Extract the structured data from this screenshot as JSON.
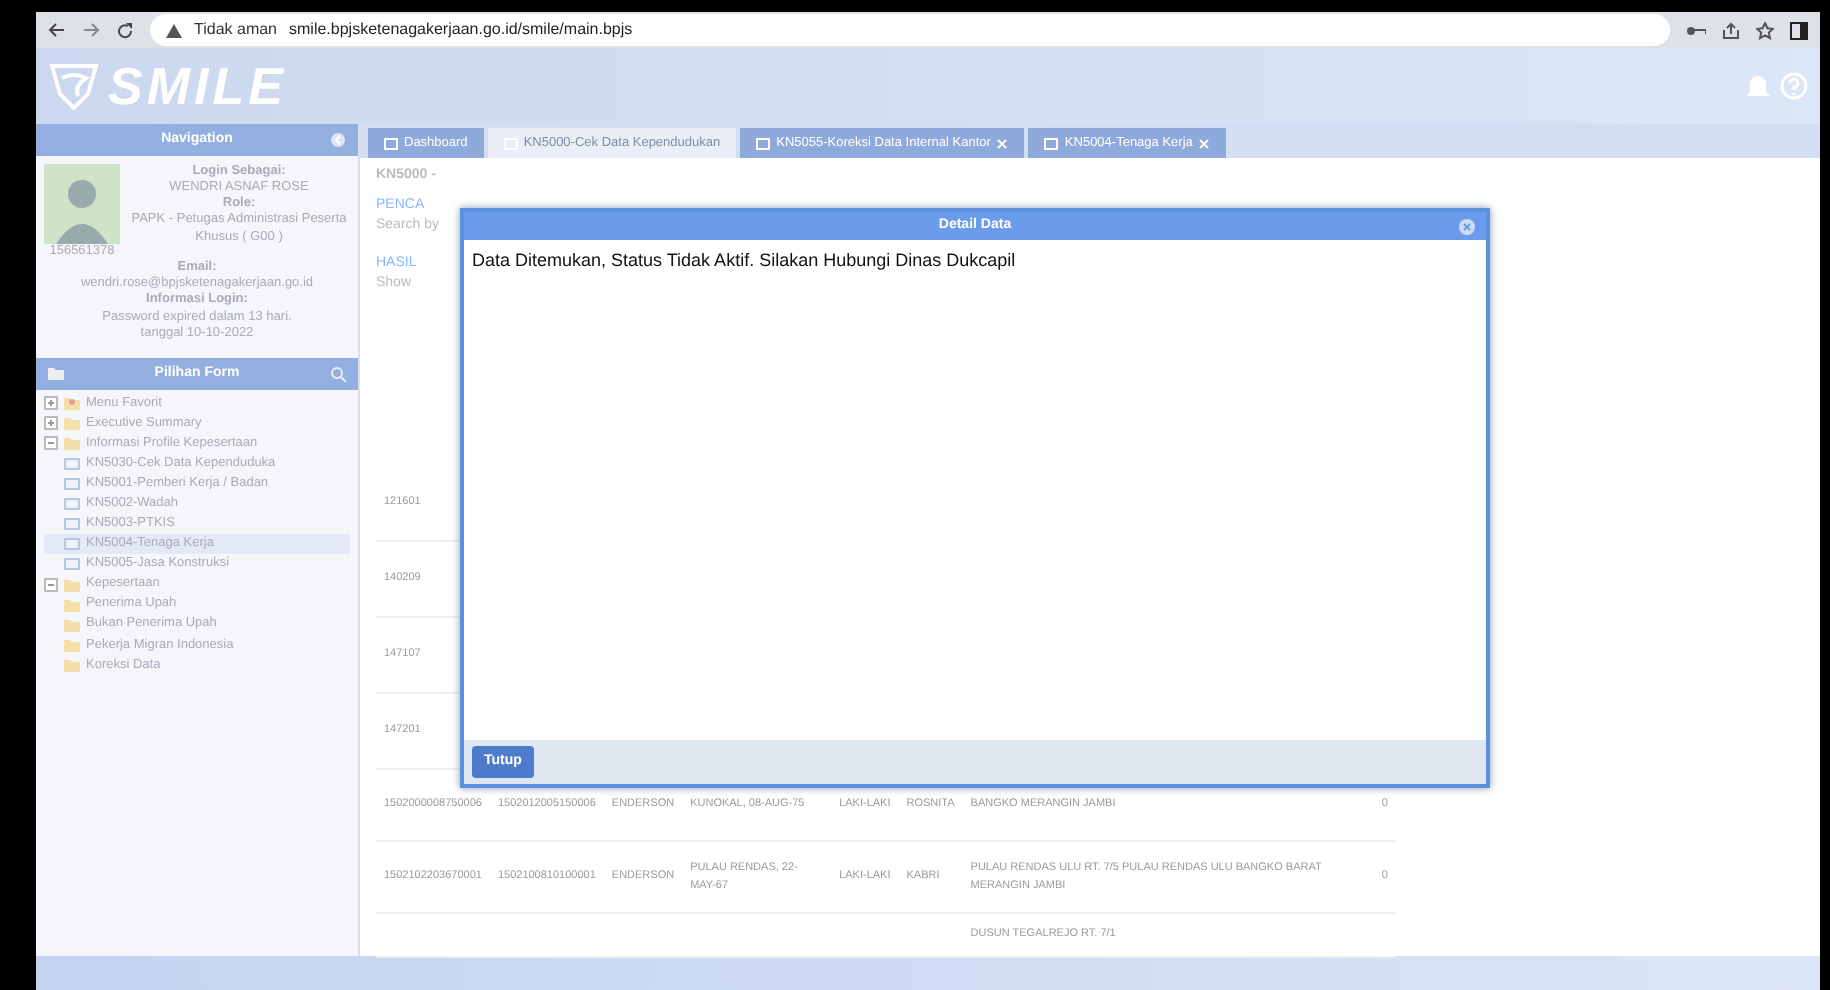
{
  "browser": {
    "security_label": "Tidak aman",
    "url": "smile.bpjsketenagakerjaan.go.id/smile/main.bpjs"
  },
  "header": {
    "logo_text": "SMILE"
  },
  "tabs": [
    {
      "label": "Dashboard",
      "selected": false,
      "closable": false
    },
    {
      "label": "KN5000-Cek Data Kependudukan",
      "selected": true,
      "closable": false
    },
    {
      "label": "KN5055-Koreksi Data Internal Kantor",
      "selected": false,
      "closable": true
    },
    {
      "label": "KN5004-Tenaga Kerja",
      "selected": false,
      "closable": true
    }
  ],
  "sidebar": {
    "title": "Navigation",
    "profile": {
      "id": "156561378",
      "login_label": "Login Sebagai:",
      "user": "WENDRI ASNAF ROSE",
      "role_label": "Role:",
      "role": "PAPK - Petugas Administrasi Peserta Khusus ( G00 )",
      "email_label": "Email:",
      "email": "wendri.rose@bpjsketenagakerjaan.go.id",
      "info_label": "Informasi Login:",
      "info": "Password expired dalam 13 hari.",
      "info_date": "tanggal 10-10-2022"
    },
    "form_title": "Pilihan Form",
    "tree": [
      {
        "label": "Menu Favorit",
        "kind": "star",
        "expanded": false,
        "selected": false
      },
      {
        "label": "Executive Summary",
        "kind": "folder",
        "expanded": false,
        "selected": false
      },
      {
        "label": "Informasi Profile Kepesertaan",
        "kind": "folder",
        "expanded": true,
        "selected": false,
        "children": [
          {
            "label": "KN5030-Cek Data Kependuduka",
            "kind": "form",
            "selected": false
          },
          {
            "label": "KN5001-Pemberi Kerja / Badan",
            "kind": "form",
            "selected": false
          },
          {
            "label": "KN5002-Wadah",
            "kind": "form",
            "selected": false
          },
          {
            "label": "KN5003-PTKIS",
            "kind": "form",
            "selected": false
          },
          {
            "label": "KN5004-Tenaga Kerja",
            "kind": "form",
            "selected": true
          },
          {
            "label": "KN5005-Jasa Konstruksi",
            "kind": "form",
            "selected": false
          }
        ]
      },
      {
        "label": "Kepesertaan",
        "kind": "folder",
        "expanded": true,
        "selected": false,
        "children": [
          {
            "label": "Penerima Upah",
            "kind": "folder",
            "selected": false
          },
          {
            "label": "Bukan Penerima Upah",
            "kind": "folder",
            "selected": false
          },
          {
            "label": "Pekerja Migran Indonesia",
            "kind": "folder",
            "selected": false
          },
          {
            "label": "Koreksi Data",
            "kind": "folder",
            "selected": false
          }
        ]
      }
    ]
  },
  "content": {
    "title": "KN5000 -",
    "search_legend": "PENCA",
    "search_label": "Search by",
    "result_legend": "HASIL",
    "show_label": "Show",
    "rows": [
      [
        "121601"
      ],
      [
        "140209"
      ],
      [
        "147107"
      ],
      [
        "147201"
      ],
      [
        "1502000008750006",
        "1502012005150006",
        "ENDERSON",
        "KUNOKAL, 08-AUG-75",
        "LAKI-LAKI",
        "ROSNITA",
        "BANGKO MERANGIN JAMBI",
        "0"
      ],
      [
        "1502102203670001",
        "1502100810100001",
        "ENDERSON",
        "PULAU RENDAS, 22-MAY-67",
        "LAKI-LAKI",
        "KABRI",
        "PULAU RENDAS ULU RT. 7/5 PULAU RENDAS ULU BANGKO BARAT MERANGIN JAMBI",
        "0"
      ],
      [
        "",
        "",
        "",
        "",
        "",
        "",
        "DUSUN TEGALREJO RT. 7/1",
        ""
      ]
    ]
  },
  "modal": {
    "title": "Detail Data",
    "message": "Data Ditemukan, Status Tidak Aktif. Silakan Hubungi Dinas Dukcapil",
    "button": "Tutup"
  }
}
